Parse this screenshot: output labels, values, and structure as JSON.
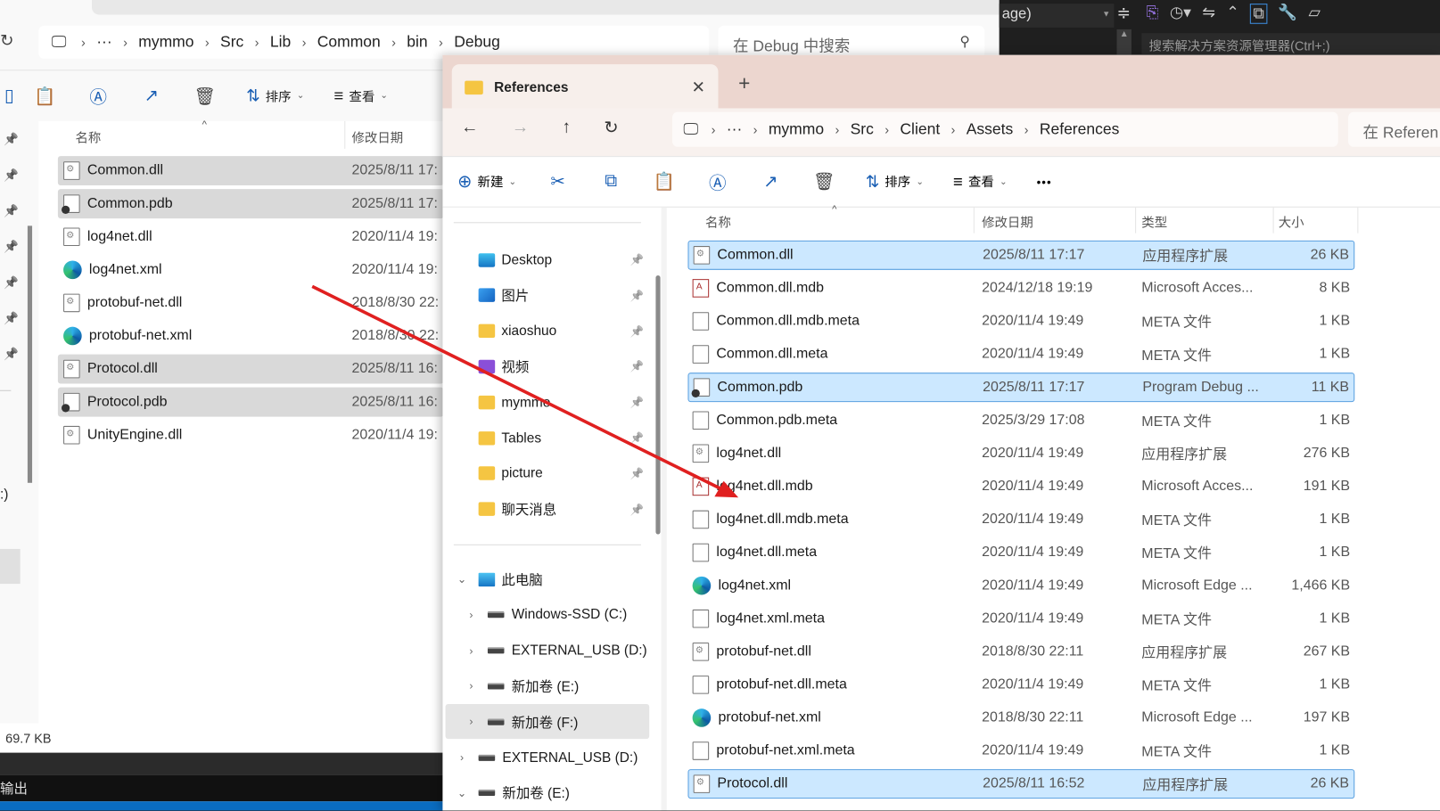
{
  "left_window": {
    "breadcrumb": [
      "mymmo",
      "Src",
      "Lib",
      "Common",
      "bin",
      "Debug"
    ],
    "search_placeholder": "在 Debug 中搜索",
    "toolbar": {
      "sort": "排序",
      "view": "查看"
    },
    "columns": {
      "name": "名称",
      "date": "修改日期"
    },
    "files": [
      {
        "name": "Common.dll",
        "date": "2025/8/11 17:",
        "icon": "dll",
        "selected": true
      },
      {
        "name": "Common.pdb",
        "date": "2025/8/11 17:",
        "icon": "pdb",
        "selected": true
      },
      {
        "name": "log4net.dll",
        "date": "2020/11/4 19:",
        "icon": "dll",
        "selected": false
      },
      {
        "name": "log4net.xml",
        "date": "2020/11/4 19:",
        "icon": "edge",
        "selected": false
      },
      {
        "name": "protobuf-net.dll",
        "date": "2018/8/30 22:",
        "icon": "dll",
        "selected": false
      },
      {
        "name": "protobuf-net.xml",
        "date": "2018/8/30 22:",
        "icon": "edge",
        "selected": false
      },
      {
        "name": "Protocol.dll",
        "date": "2025/8/11 16:",
        "icon": "dll",
        "selected": true
      },
      {
        "name": "Protocol.pdb",
        "date": "2025/8/11 16:",
        "icon": "pdb",
        "selected": true
      },
      {
        "name": "UnityEngine.dll",
        "date": "2020/11/4 19:",
        "icon": "dll",
        "selected": false
      }
    ],
    "status": "69.7 KB",
    "side_fragment": ":)",
    "output_panel": "输出"
  },
  "vs": {
    "dropdown_fragment": "age)",
    "solution_search": "搜索解决方案资源管理器(Ctrl+;)"
  },
  "right_window": {
    "tab_title": "References",
    "new_tab": "+",
    "breadcrumb": [
      "mymmo",
      "Src",
      "Client",
      "Assets",
      "References"
    ],
    "search_placeholder": "在 Referen",
    "toolbar": {
      "new": "新建",
      "sort": "排序",
      "view": "查看",
      "more": "•••"
    },
    "nav_quick": [
      {
        "label": "Desktop",
        "icon": "desktop"
      },
      {
        "label": "图片",
        "icon": "pictures"
      },
      {
        "label": "xiaoshuo",
        "icon": "folder"
      },
      {
        "label": "视频",
        "icon": "videos"
      },
      {
        "label": "mymmo",
        "icon": "folder"
      },
      {
        "label": "Tables",
        "icon": "folder"
      },
      {
        "label": "picture",
        "icon": "folder"
      },
      {
        "label": "聊天消息",
        "icon": "folder"
      }
    ],
    "nav_tree": [
      {
        "label": "此电脑",
        "expand": "⌄",
        "level": 0,
        "icon": "pc"
      },
      {
        "label": "Windows-SSD (C:)",
        "expand": "›",
        "level": 1,
        "icon": "drive"
      },
      {
        "label": "EXTERNAL_USB (D:)",
        "expand": "›",
        "level": 1,
        "icon": "drive"
      },
      {
        "label": "新加卷 (E:)",
        "expand": "›",
        "level": 1,
        "icon": "drive"
      },
      {
        "label": "新加卷 (F:)",
        "expand": "›",
        "level": 1,
        "icon": "drive",
        "highlight": true
      },
      {
        "label": "EXTERNAL_USB (D:)",
        "expand": "›",
        "level": 0,
        "icon": "drive"
      },
      {
        "label": "新加卷 (E:)",
        "expand": "⌄",
        "level": 0,
        "icon": "drive"
      }
    ],
    "columns": {
      "name": "名称",
      "date": "修改日期",
      "type": "类型",
      "size": "大小"
    },
    "files": [
      {
        "name": "Common.dll",
        "date": "2025/8/11 17:17",
        "type": "应用程序扩展",
        "size": "26 KB",
        "icon": "dll",
        "selected": true
      },
      {
        "name": "Common.dll.mdb",
        "date": "2024/12/18 19:19",
        "type": "Microsoft Acces...",
        "size": "8 KB",
        "icon": "mdb"
      },
      {
        "name": "Common.dll.mdb.meta",
        "date": "2020/11/4 19:49",
        "type": "META 文件",
        "size": "1 KB",
        "icon": "file"
      },
      {
        "name": "Common.dll.meta",
        "date": "2020/11/4 19:49",
        "type": "META 文件",
        "size": "1 KB",
        "icon": "file"
      },
      {
        "name": "Common.pdb",
        "date": "2025/8/11 17:17",
        "type": "Program Debug ...",
        "size": "11 KB",
        "icon": "pdb",
        "selected": true
      },
      {
        "name": "Common.pdb.meta",
        "date": "2025/3/29 17:08",
        "type": "META 文件",
        "size": "1 KB",
        "icon": "file"
      },
      {
        "name": "log4net.dll",
        "date": "2020/11/4 19:49",
        "type": "应用程序扩展",
        "size": "276 KB",
        "icon": "dll"
      },
      {
        "name": "log4net.dll.mdb",
        "date": "2020/11/4 19:49",
        "type": "Microsoft Acces...",
        "size": "191 KB",
        "icon": "mdb"
      },
      {
        "name": "log4net.dll.mdb.meta",
        "date": "2020/11/4 19:49",
        "type": "META 文件",
        "size": "1 KB",
        "icon": "file"
      },
      {
        "name": "log4net.dll.meta",
        "date": "2020/11/4 19:49",
        "type": "META 文件",
        "size": "1 KB",
        "icon": "file"
      },
      {
        "name": "log4net.xml",
        "date": "2020/11/4 19:49",
        "type": "Microsoft Edge ...",
        "size": "1,466 KB",
        "icon": "edge"
      },
      {
        "name": "log4net.xml.meta",
        "date": "2020/11/4 19:49",
        "type": "META 文件",
        "size": "1 KB",
        "icon": "file"
      },
      {
        "name": "protobuf-net.dll",
        "date": "2018/8/30 22:11",
        "type": "应用程序扩展",
        "size": "267 KB",
        "icon": "dll"
      },
      {
        "name": "protobuf-net.dll.meta",
        "date": "2020/11/4 19:49",
        "type": "META 文件",
        "size": "1 KB",
        "icon": "file"
      },
      {
        "name": "protobuf-net.xml",
        "date": "2018/8/30 22:11",
        "type": "Microsoft Edge ...",
        "size": "197 KB",
        "icon": "edge"
      },
      {
        "name": "protobuf-net.xml.meta",
        "date": "2020/11/4 19:49",
        "type": "META 文件",
        "size": "1 KB",
        "icon": "file"
      },
      {
        "name": "Protocol.dll",
        "date": "2025/8/11 16:52",
        "type": "应用程序扩展",
        "size": "26 KB",
        "icon": "dll",
        "selected": true
      }
    ]
  },
  "annotation": {
    "arrow_color": "#e02020"
  }
}
